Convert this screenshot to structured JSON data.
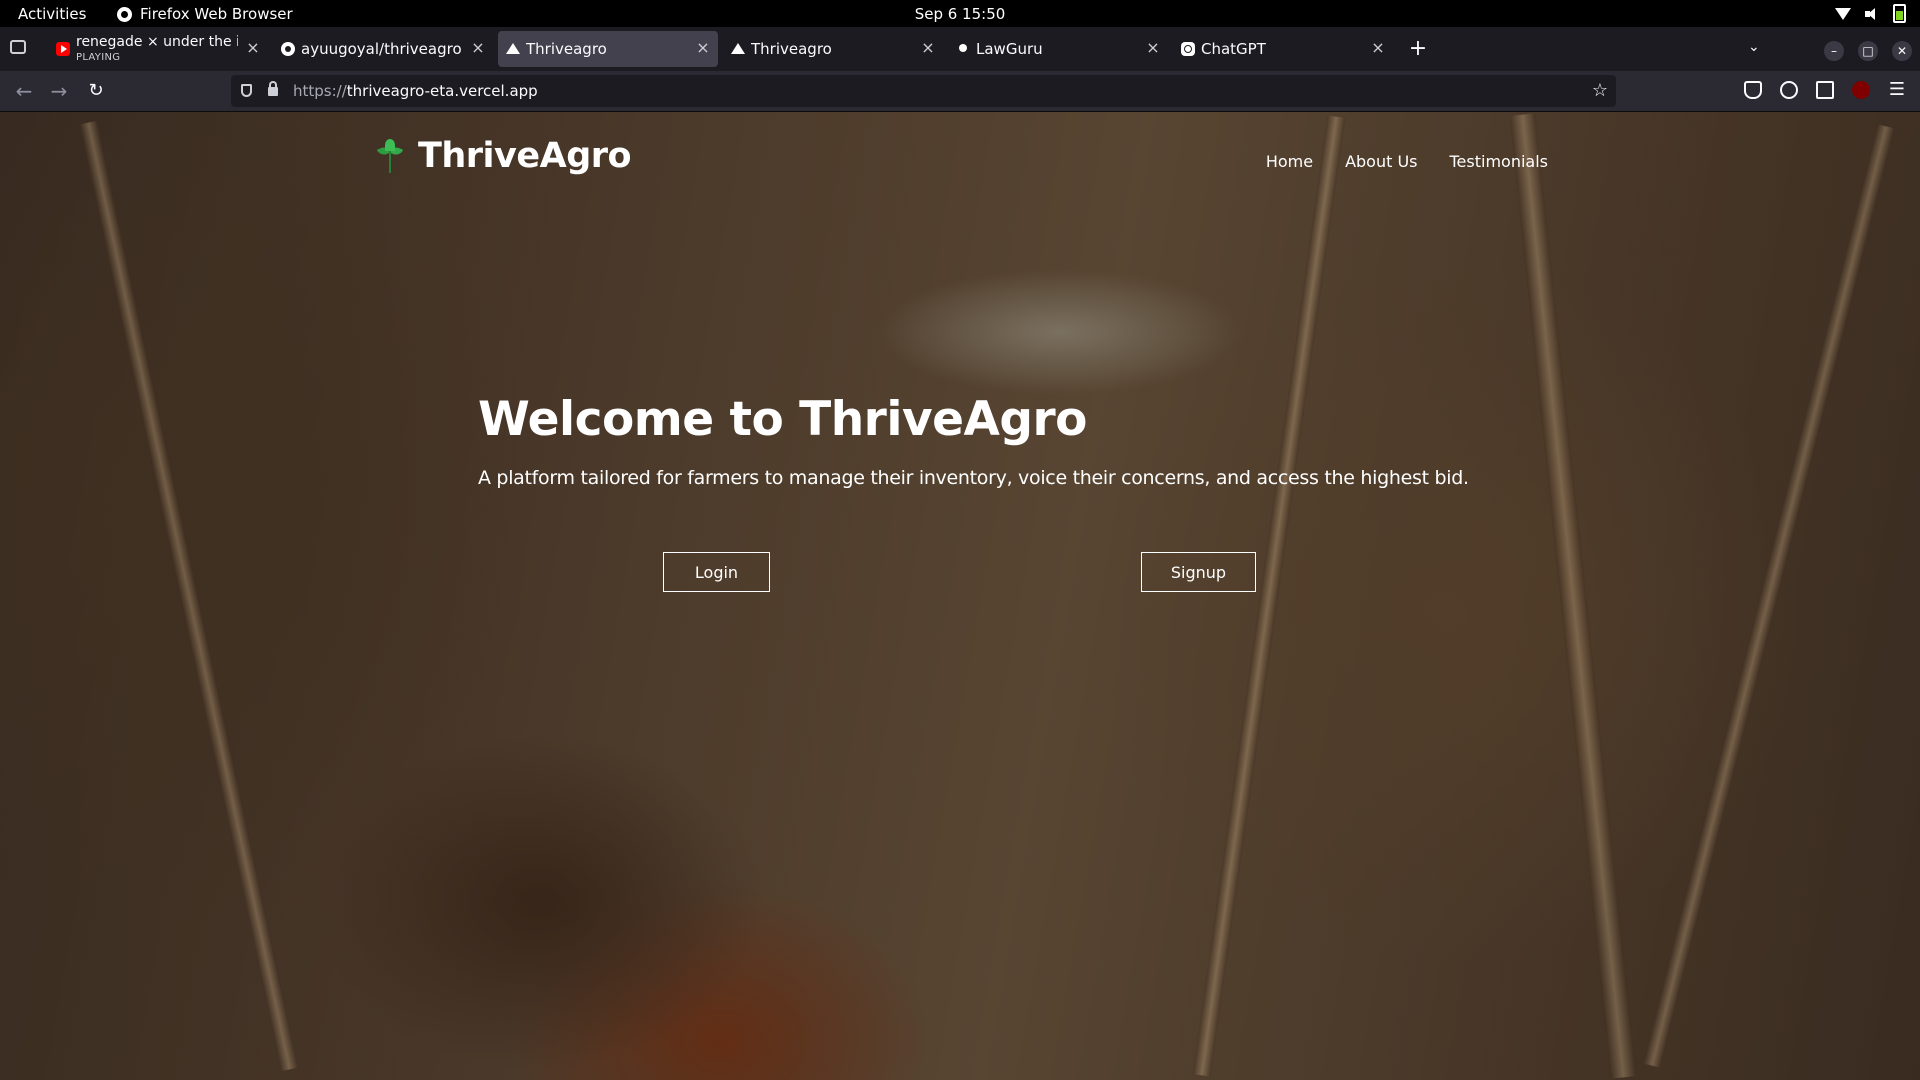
{
  "system_bar": {
    "activities": "Activities",
    "app_name": "Firefox Web Browser",
    "clock": "Sep 6  15:50"
  },
  "tabs": [
    {
      "title": "renegade × under the inf",
      "subtitle": "PLAYING",
      "icon": "youtube-icon",
      "active": false
    },
    {
      "title": "ayuugoyal/thriveagro: Th",
      "icon": "github-icon",
      "active": false
    },
    {
      "title": "Thriveagro",
      "icon": "vercel-icon",
      "active": true
    },
    {
      "title": "Thriveagro",
      "icon": "vercel-icon",
      "active": false
    },
    {
      "title": "LawGuru",
      "icon": "lawguru-icon",
      "active": false
    },
    {
      "title": "ChatGPT",
      "icon": "chatgpt-icon",
      "active": false
    }
  ],
  "browser": {
    "url_protocol": "https://",
    "url_host": "thriveagro-eta.vercel.app",
    "new_tab": "+",
    "close_glyph": "×"
  },
  "site": {
    "brand": "ThriveAgro",
    "nav": [
      "Home",
      "About Us",
      "Testimonials"
    ],
    "hero_title": "Welcome to ThriveAgro",
    "hero_subtitle": "A platform tailored for farmers to manage their inventory, voice their concerns, and access the highest bid.",
    "login_label": "Login",
    "signup_label": "Signup"
  },
  "colors": {
    "tab_strip": "#1c1b22",
    "active_tab": "#42414d",
    "toolbar": "#2b2a33",
    "logo_green": "#34a94a"
  }
}
